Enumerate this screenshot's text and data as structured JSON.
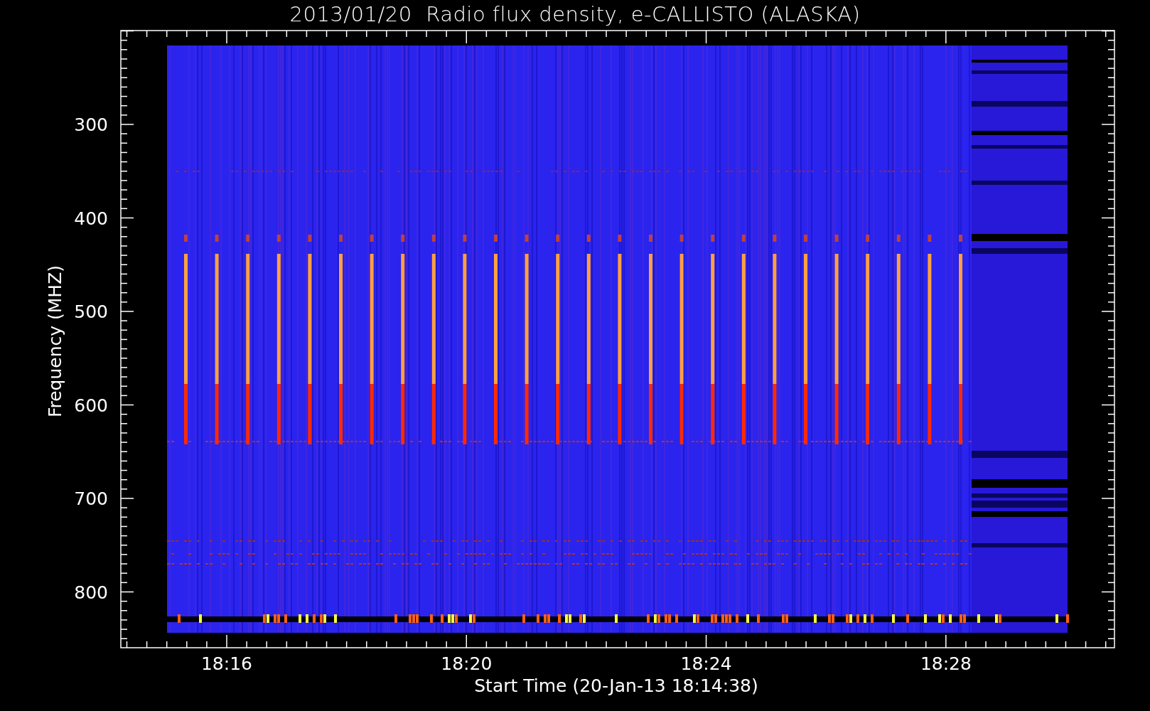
{
  "title": "2013/01/20  Radio flux density, e-CALLISTO (ALASKA)",
  "plot": {
    "ylabel": "Frequency (MHZ)",
    "xlabel": "Start Time (20-Jan-13 18:14:38)",
    "yticks": [
      "300",
      "400",
      "500",
      "600",
      "700",
      "800"
    ],
    "xticks": [
      "18:16",
      "18:20",
      "18:24",
      "18:28"
    ]
  }
}
